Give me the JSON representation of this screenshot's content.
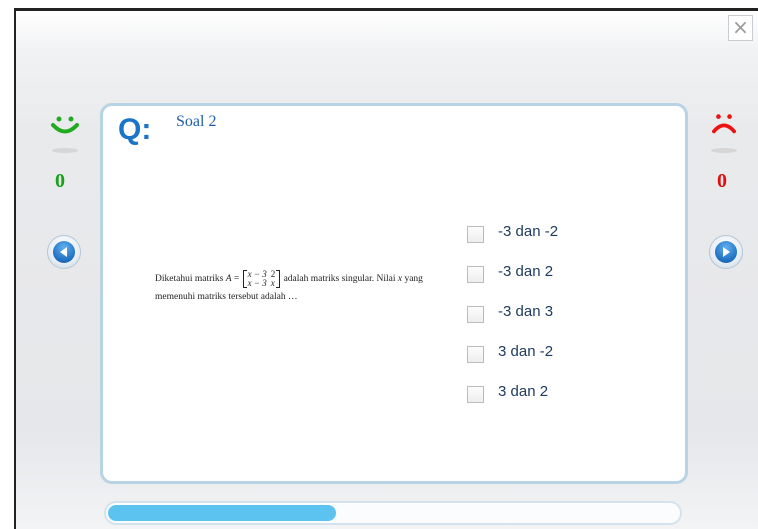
{
  "window": {
    "close_label": "×"
  },
  "question": {
    "marker": "Q:",
    "title": "Soal 2",
    "text_intro": "Diketahui matriks",
    "matrix_name": "A",
    "matrix_rows": [
      [
        "x − 3",
        "2"
      ],
      [
        "x − 3",
        "x"
      ]
    ],
    "text_after": "adalah matriks singular. Nilai",
    "variable": "x",
    "text_yang": "yang",
    "text_line2": "memenuhi matriks tersebut adalah …"
  },
  "options": [
    {
      "label": "-3 dan -2",
      "checked": false
    },
    {
      "label": "-3 dan 2",
      "checked": false
    },
    {
      "label": "-3 dan 3",
      "checked": false
    },
    {
      "label": "3 dan -2",
      "checked": false
    },
    {
      "label": "3 dan 2",
      "checked": false
    }
  ],
  "scores": {
    "correct": {
      "value": "0",
      "icon": "happy-face-icon",
      "color": "#1aa01a"
    },
    "wrong": {
      "value": "0",
      "icon": "sad-face-icon",
      "color": "#e01010"
    }
  },
  "navigation": {
    "prev_icon": "arrow-left-icon",
    "next_icon": "arrow-right-icon"
  },
  "progress": {
    "fraction": 0.4
  },
  "colors": {
    "accent": "#1a74c9",
    "card_border": "#b8d3e4",
    "progress": "#5cc3f0"
  }
}
